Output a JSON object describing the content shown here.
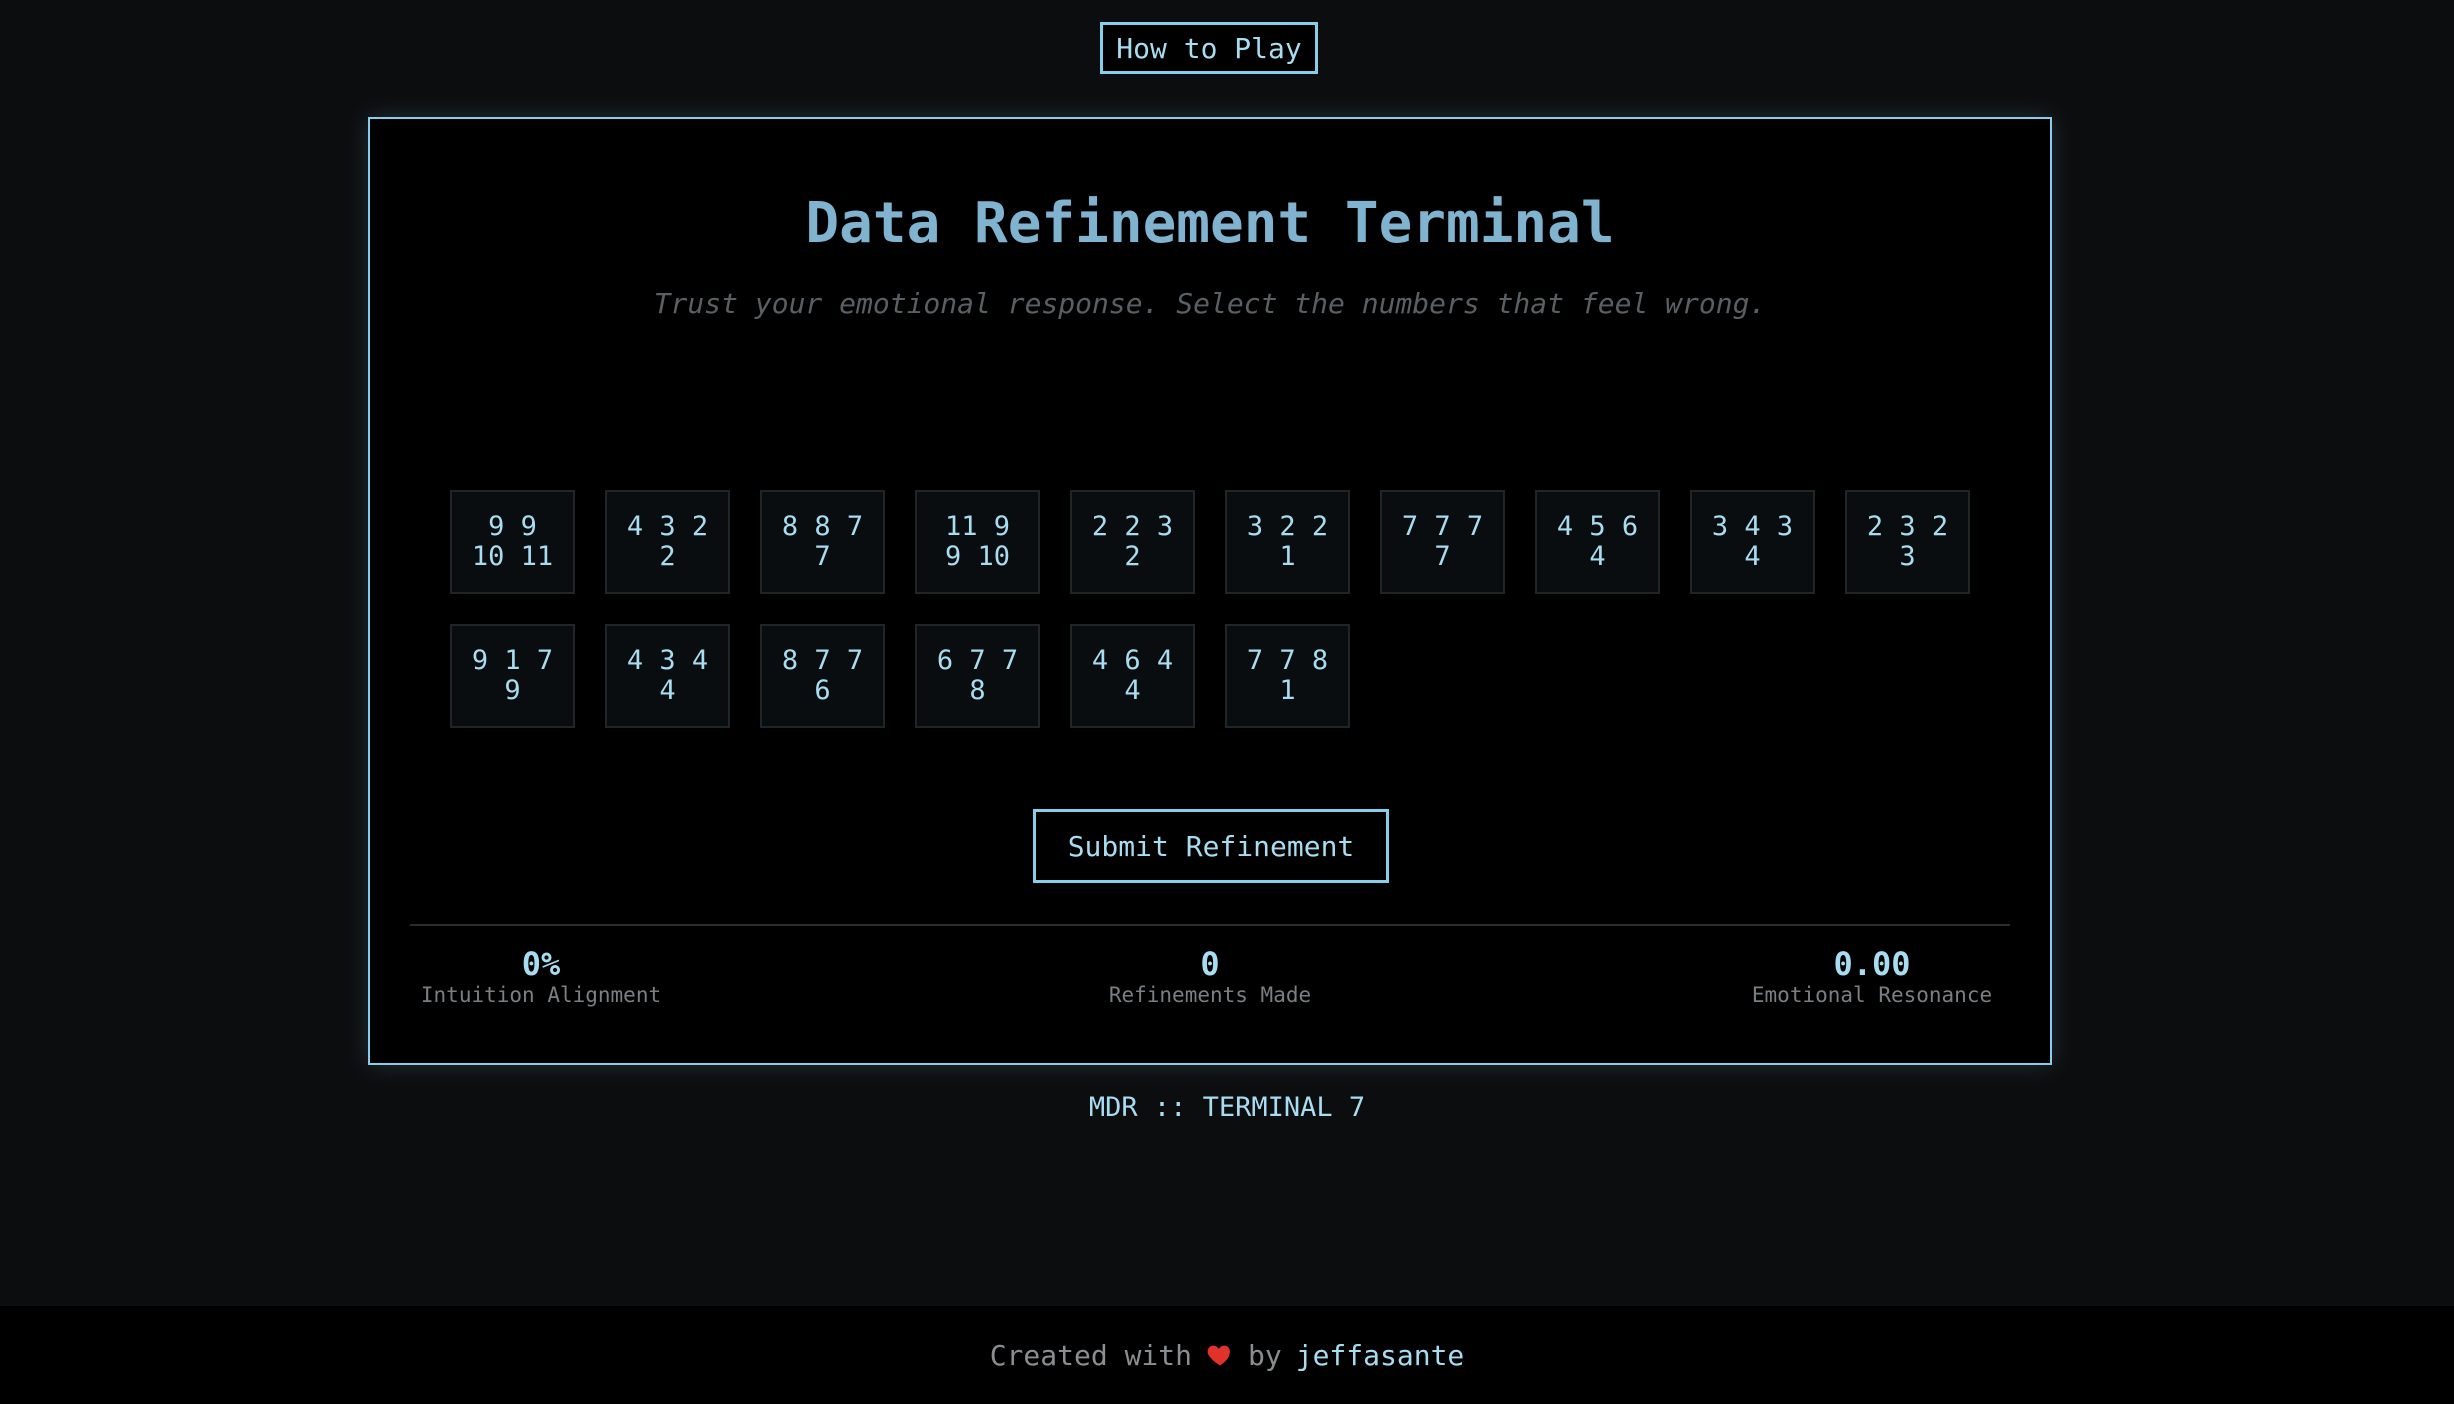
{
  "header": {
    "how_to_play": "How to Play"
  },
  "terminal": {
    "title": "Data Refinement Terminal",
    "subtitle": "Trust your emotional response. Select the numbers that feel wrong.",
    "cells": [
      {
        "line1": "9 9",
        "line2": "10 11"
      },
      {
        "line1": "4 3 2",
        "line2": "2"
      },
      {
        "line1": "8 8 7",
        "line2": "7"
      },
      {
        "line1": "11 9",
        "line2": "9 10"
      },
      {
        "line1": "2 2 3",
        "line2": "2"
      },
      {
        "line1": "3 2 2",
        "line2": "1"
      },
      {
        "line1": "7 7 7",
        "line2": "7"
      },
      {
        "line1": "4 5 6",
        "line2": "4"
      },
      {
        "line1": "3 4 3",
        "line2": "4"
      },
      {
        "line1": "2 3 2",
        "line2": "3"
      },
      {
        "line1": "9 1 7",
        "line2": "9"
      },
      {
        "line1": "4 3 4",
        "line2": "4"
      },
      {
        "line1": "8 7 7",
        "line2": "6"
      },
      {
        "line1": "6 7 7",
        "line2": "8"
      },
      {
        "line1": "4 6 4",
        "line2": "4"
      },
      {
        "line1": "7 7 8",
        "line2": "1"
      }
    ],
    "submit_label": "Submit Refinement",
    "stats": {
      "alignment": {
        "value": "0%",
        "label": "Intuition Alignment"
      },
      "refinements": {
        "value": "0",
        "label": "Refinements Made"
      },
      "resonance": {
        "value": "0.00",
        "label": "Emotional Resonance"
      }
    }
  },
  "footer_tag": "MDR :: TERMINAL 7",
  "credit": {
    "prefix": "Created with",
    "by": "by",
    "author": "jeffasante"
  },
  "colors": {
    "accent": "#87ceeb",
    "heart": "#e0312b"
  }
}
